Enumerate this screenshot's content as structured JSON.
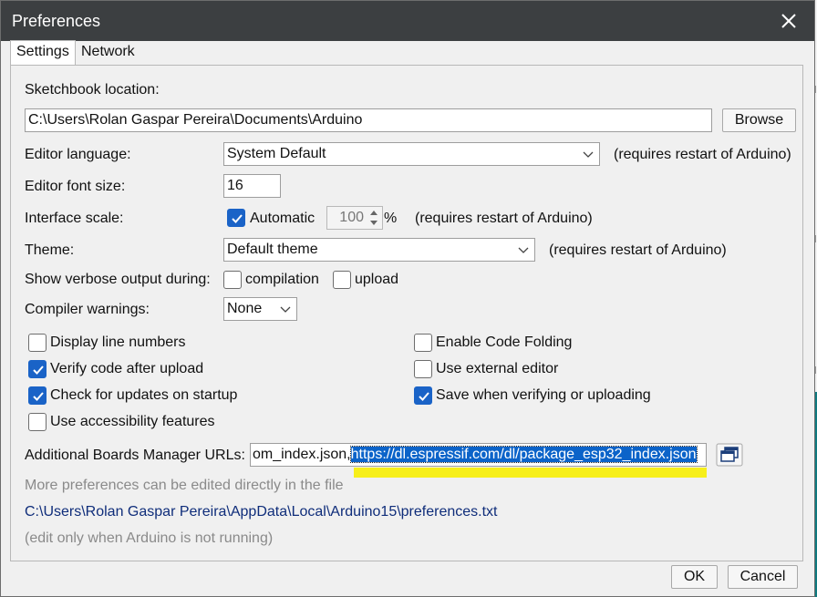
{
  "window": {
    "title": "Preferences"
  },
  "tabs": [
    {
      "label": "Settings",
      "active": true
    },
    {
      "label": "Network",
      "active": false
    }
  ],
  "sketchbook": {
    "label": "Sketchbook location:",
    "value": "C:\\Users\\Rolan Gaspar Pereira\\Documents\\Arduino",
    "browse_label": "Browse"
  },
  "editor_language": {
    "label": "Editor language:",
    "value": "System Default",
    "note": "(requires restart of Arduino)"
  },
  "font_size": {
    "label": "Editor font size:",
    "value": "16"
  },
  "interface_scale": {
    "label": "Interface scale:",
    "automatic_label": "Automatic",
    "automatic_checked": true,
    "value": "100",
    "unit": "%",
    "note": "(requires restart of Arduino)"
  },
  "theme": {
    "label": "Theme:",
    "value": "Default theme",
    "note": "(requires restart of Arduino)"
  },
  "verbose": {
    "label": "Show verbose output during:",
    "compilation_label": "compilation",
    "compilation_checked": false,
    "upload_label": "upload",
    "upload_checked": false
  },
  "compiler_warnings": {
    "label": "Compiler warnings:",
    "value": "None"
  },
  "options_left": [
    {
      "label": "Display line numbers",
      "checked": false
    },
    {
      "label": "Verify code after upload",
      "checked": true
    },
    {
      "label": "Check for updates on startup",
      "checked": true
    },
    {
      "label": "Use accessibility features",
      "checked": false
    }
  ],
  "options_right": [
    {
      "label": "Enable Code Folding",
      "checked": false
    },
    {
      "label": "Use external editor",
      "checked": false
    },
    {
      "label": "Save when verifying or uploading",
      "checked": true
    }
  ],
  "boards_urls": {
    "label": "Additional Boards Manager URLs:",
    "value_prefix": "om_index.json,",
    "value_selected": "https://dl.espressif.com/dl/package_esp32_index.json"
  },
  "more_prefs": {
    "hint": "More preferences can be edited directly in the file",
    "path": "C:\\Users\\Rolan Gaspar Pereira\\AppData\\Local\\Arduino15\\preferences.txt",
    "note": "(edit only when Arduino is not running)"
  },
  "footer": {
    "ok_label": "OK",
    "cancel_label": "Cancel"
  },
  "colors": {
    "titlebar": "#3c3f41",
    "checkbox_checked": "#1a63c7",
    "selection": "#0b63c9",
    "highlight": "#f7ef1a",
    "path_link": "#0f2d7a"
  }
}
